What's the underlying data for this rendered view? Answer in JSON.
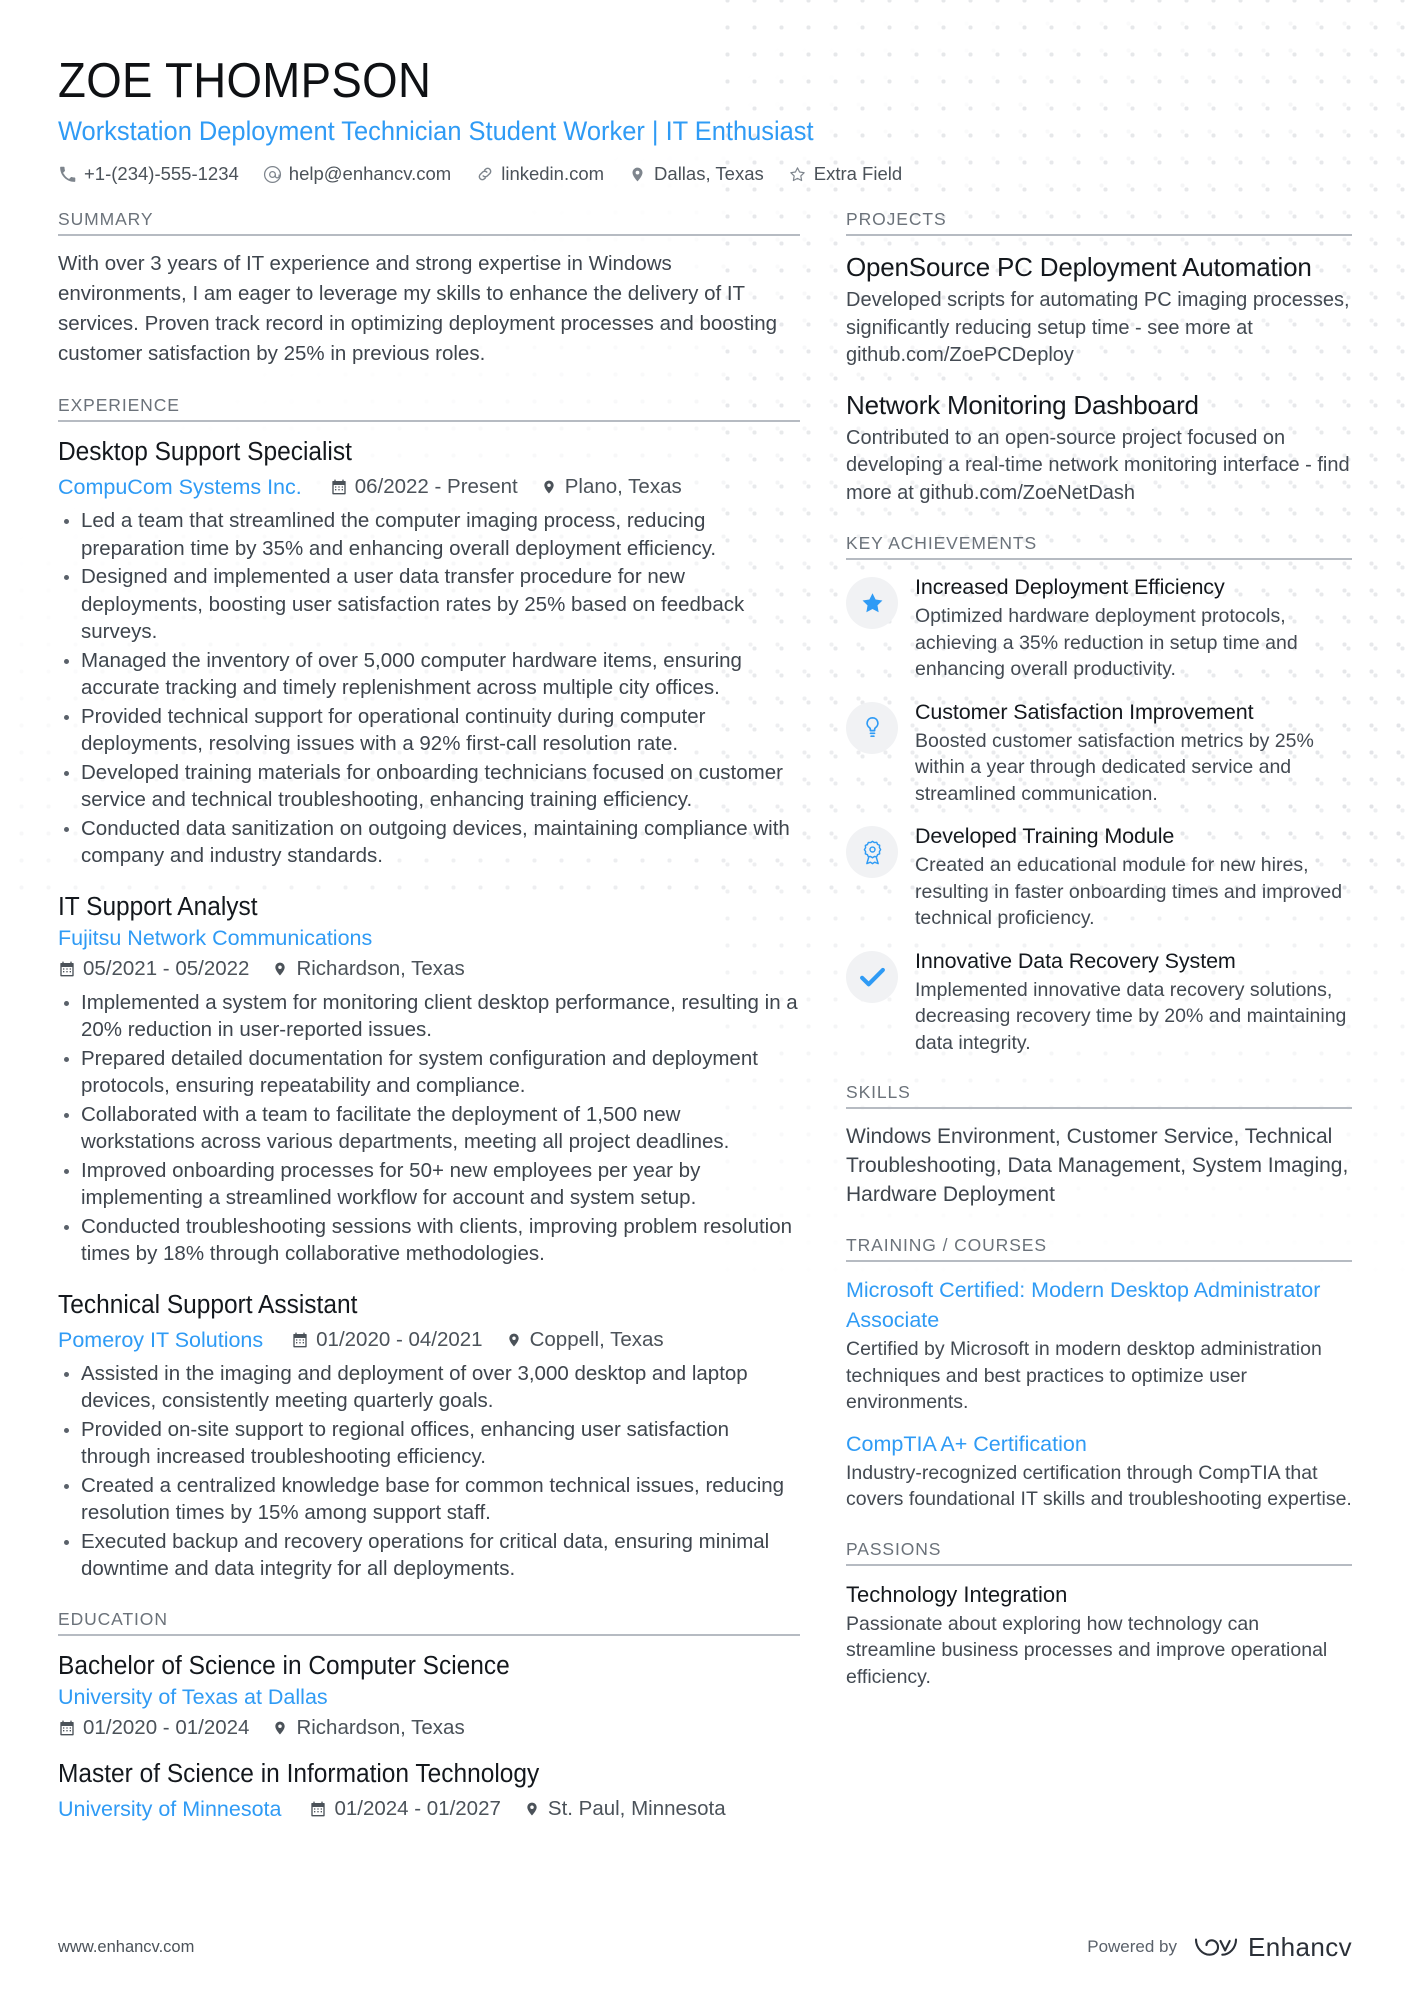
{
  "header": {
    "name": "ZOE THOMPSON",
    "headline": "Workstation Deployment Technician Student Worker | IT Enthusiast",
    "contacts": [
      {
        "icon": "phone-icon",
        "text": "+1-(234)-555-1234"
      },
      {
        "icon": "email-icon",
        "text": "help@enhancv.com"
      },
      {
        "icon": "link-icon",
        "text": "linkedin.com"
      },
      {
        "icon": "location-pin-icon",
        "text": "Dallas, Texas"
      },
      {
        "icon": "star-outline-icon",
        "text": "Extra Field"
      }
    ]
  },
  "accent_color": "#2f9bf5",
  "sections": {
    "summary": {
      "title": "SUMMARY",
      "text": "With over 3 years of IT experience and strong expertise in Windows environments, I am eager to leverage my skills to enhance the delivery of IT services. Proven track record in optimizing deployment processes and boosting customer satisfaction by 25% in previous roles."
    },
    "experience": {
      "title": "EXPERIENCE",
      "jobs": [
        {
          "title": "Desktop Support Specialist",
          "company": "CompuCom Systems Inc.",
          "dates": "06/2022 - Present",
          "location": "Plano, Texas",
          "bullets": [
            "Led a team that streamlined the computer imaging process, reducing preparation time by 35% and enhancing overall deployment efficiency.",
            "Designed and implemented a user data transfer procedure for new deployments, boosting user satisfaction rates by 25% based on feedback surveys.",
            "Managed the inventory of over 5,000 computer hardware items, ensuring accurate tracking and timely replenishment across multiple city offices.",
            "Provided technical support for operational continuity during computer deployments, resolving issues with a 92% first-call resolution rate.",
            "Developed training materials for onboarding technicians focused on customer service and technical troubleshooting, enhancing training efficiency.",
            "Conducted data sanitization on outgoing devices, maintaining compliance with company and industry standards."
          ]
        },
        {
          "title": "IT Support Analyst",
          "company": "Fujitsu Network Communications",
          "dates": "05/2021 - 05/2022",
          "location": "Richardson, Texas",
          "bullets": [
            "Implemented a system for monitoring client desktop performance, resulting in a 20% reduction in user-reported issues.",
            "Prepared detailed documentation for system configuration and deployment protocols, ensuring repeatability and compliance.",
            "Collaborated with a team to facilitate the deployment of 1,500 new workstations across various departments, meeting all project deadlines.",
            "Improved onboarding processes for 50+ new employees per year by implementing a streamlined workflow for account and system setup.",
            "Conducted troubleshooting sessions with clients, improving problem resolution times by 18% through collaborative methodologies."
          ]
        },
        {
          "title": "Technical Support Assistant",
          "company": "Pomeroy IT Solutions",
          "dates": "01/2020 - 04/2021",
          "location": "Coppell, Texas",
          "bullets": [
            "Assisted in the imaging and deployment of over 3,000 desktop and laptop devices, consistently meeting quarterly goals.",
            "Provided on-site support to regional offices, enhancing user satisfaction through increased troubleshooting efficiency.",
            "Created a centralized knowledge base for common technical issues, reducing resolution times by 15% among support staff.",
            "Executed backup and recovery operations for critical data, ensuring minimal downtime and data integrity for all deployments."
          ]
        }
      ]
    },
    "education": {
      "title": "EDUCATION",
      "entries": [
        {
          "degree": "Bachelor of Science in Computer Science",
          "school": "University of Texas at Dallas",
          "dates": "01/2020 - 01/2024",
          "location": "Richardson, Texas",
          "inline": false
        },
        {
          "degree": "Master of Science in Information Technology",
          "school": "University of Minnesota",
          "dates": "01/2024 - 01/2027",
          "location": "St. Paul, Minnesota",
          "inline": true
        }
      ]
    },
    "projects": {
      "title": "PROJECTS",
      "items": [
        {
          "title": "OpenSource PC Deployment Automation",
          "description": "Developed scripts for automating PC imaging processes, significantly reducing setup time - see more at github.com/ZoePCDeploy"
        },
        {
          "title": "Network Monitoring Dashboard",
          "description": "Contributed to an open-source project focused on developing a real-time network monitoring interface - find more at github.com/ZoeNetDash"
        }
      ]
    },
    "key_achievements": {
      "title": "KEY ACHIEVEMENTS",
      "items": [
        {
          "icon": "star-icon",
          "title": "Increased Deployment Efficiency",
          "description": "Optimized hardware deployment protocols, achieving a 35% reduction in setup time and enhancing overall productivity."
        },
        {
          "icon": "lightbulb-icon",
          "title": "Customer Satisfaction Improvement",
          "description": "Boosted customer satisfaction metrics by 25% within a year through dedicated service and streamlined communication."
        },
        {
          "icon": "award-ribbon-icon",
          "title": "Developed Training Module",
          "description": "Created an educational module for new hires, resulting in faster onboarding times and improved technical proficiency."
        },
        {
          "icon": "check-icon",
          "title": "Innovative Data Recovery System",
          "description": "Implemented innovative data recovery solutions, decreasing recovery time by 20% and maintaining data integrity."
        }
      ]
    },
    "skills": {
      "title": "SKILLS",
      "text": "Windows Environment, Customer Service, Technical Troubleshooting, Data Management, System Imaging, Hardware Deployment"
    },
    "training": {
      "title": "TRAINING / COURSES",
      "items": [
        {
          "title": "Microsoft Certified: Modern Desktop Administrator Associate",
          "description": "Certified by Microsoft in modern desktop administration techniques and best practices to optimize user environments."
        },
        {
          "title": "CompTIA A+ Certification",
          "description": "Industry-recognized certification through CompTIA that covers foundational IT skills and troubleshooting expertise."
        }
      ]
    },
    "passions": {
      "title": "PASSIONS",
      "items": [
        {
          "title": "Technology Integration",
          "description": "Passionate about exploring how technology can streamline business processes and improve operational efficiency."
        }
      ]
    }
  },
  "footer": {
    "website": "www.enhancv.com",
    "powered_by": "Powered by",
    "brand": "Enhancv"
  }
}
